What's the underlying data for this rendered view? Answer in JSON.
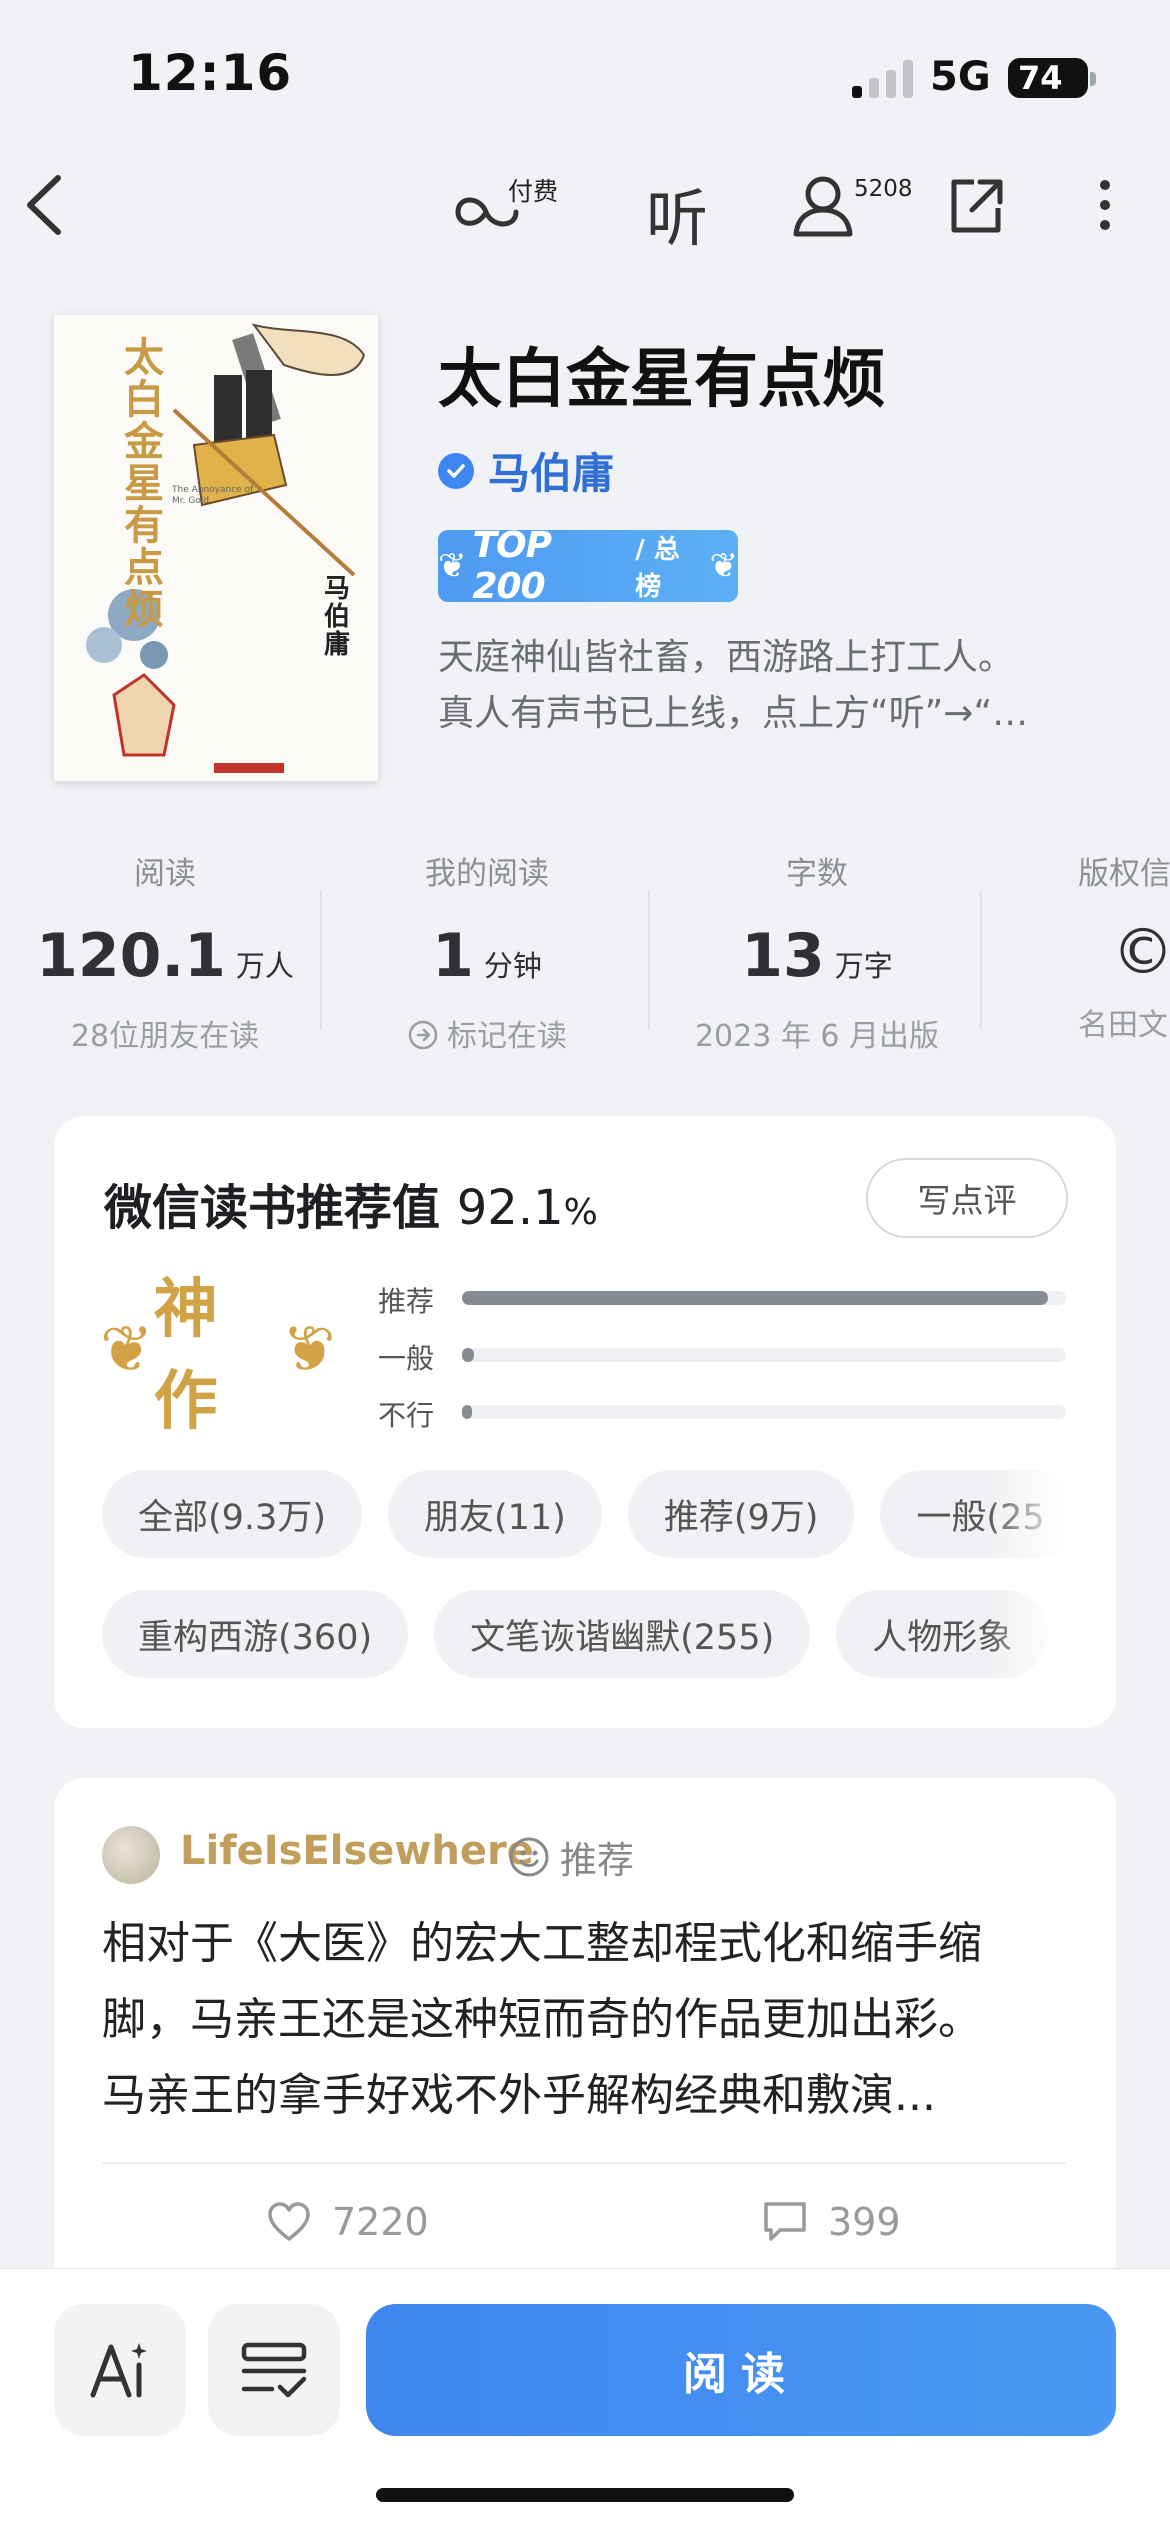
{
  "status": {
    "time": "12:16",
    "network": "5G",
    "battery": "74"
  },
  "nav": {
    "pay_label": "付费",
    "listen_label": "听",
    "user_count": "5208"
  },
  "book": {
    "title": "太白金星有点烦",
    "author": "马伯庸",
    "badge_top": "TOP 200",
    "badge_list": "/ 总榜",
    "desc_line1": "天庭神仙皆社畜，西游路上打工人。",
    "desc_line2": "真人有声书已上线，点上方“听”→“…",
    "cover": {
      "title_chars": "太白金星有点烦",
      "author": "马伯庸",
      "subtitle": "The Annoyance of Mr. Gold"
    }
  },
  "stats": [
    {
      "label": "阅读",
      "value": "120.1",
      "unit": "万人",
      "sub": "28位朋友在读"
    },
    {
      "label": "我的阅读",
      "value": "1",
      "unit": "分钟",
      "sub": "标记在读"
    },
    {
      "label": "字数",
      "value": "13",
      "unit": "万字",
      "sub": "2023 年 6 月出版"
    },
    {
      "label": "版权信",
      "value": "©",
      "unit": "",
      "sub": "名田文"
    }
  ],
  "recommend": {
    "title": "微信读书推荐值",
    "percent": "92.1",
    "percent_sign": "%",
    "write_review": "写点评",
    "level": "神作",
    "bars": [
      {
        "label": "推荐",
        "fraction": 0.97
      },
      {
        "label": "一般",
        "fraction": 0.02
      },
      {
        "label": "不行",
        "fraction": 0.006
      }
    ],
    "chips_row1": [
      "全部(9.3万)",
      "朋友(11)",
      "推荐(9万)",
      "一般(25"
    ],
    "chips_row2": [
      "重构西游(360)",
      "文笔诙谐幽默(255)",
      "人物形象"
    ]
  },
  "review": {
    "user": "LifeIsElsewhere",
    "tag": "推荐",
    "line1": "相对于《大医》的宏大工整却程式化和缩手缩",
    "line2": "脚，马亲王还是这种短而奇的作品更加出彩。",
    "line3": "马亲王的拿手好戏不外乎解构经典和敷演...",
    "likes": "7220",
    "comments": "399"
  },
  "bottom": {
    "read_label": "阅读"
  },
  "colors": {
    "accent": "#3f86ef",
    "author": "#2f6fd6",
    "gold": "#d2a246"
  }
}
